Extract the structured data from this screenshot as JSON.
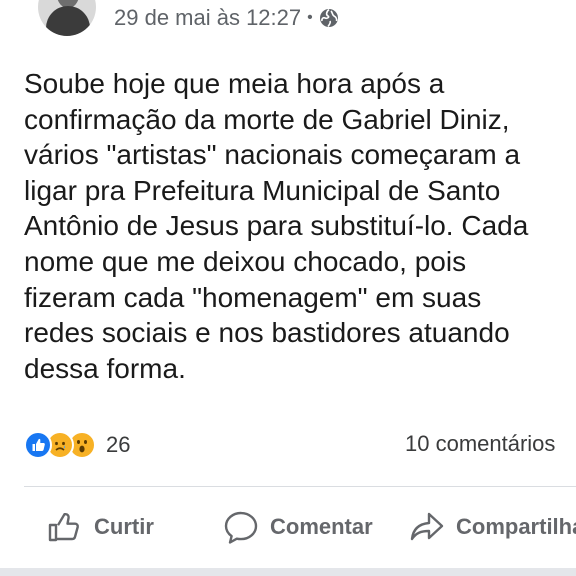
{
  "post": {
    "timestamp": "29 de mai às 12:27",
    "separator": "•",
    "privacy_icon": "globe-icon",
    "text_lines": [
      "Soube hoje que meia hora após a",
      "confirmação da morte de Gabriel Diniz,",
      "vários \"artistas\" nacionais começaram a",
      "ligar pra Prefeitura Municipal de Santo",
      "Antônio de Jesus para substituí-lo. Cada",
      "nome que me deixou chocado, pois",
      "fizeram cada \"homenagem\" em suas",
      "redes sociais e nos bastidores atuando",
      "dessa forma."
    ]
  },
  "reactions": {
    "icons": [
      "like-icon",
      "sad-icon",
      "wow-icon"
    ],
    "count": "26",
    "comments": "10 comentários"
  },
  "actions": {
    "like": "Curtir",
    "comment": "Comentar",
    "share": "Compartilhar"
  },
  "colors": {
    "like_blue": "#1877f2",
    "emoji_yellow": "#f7b125",
    "action_gray": "#65676b",
    "meta_gray": "#5f6368"
  }
}
